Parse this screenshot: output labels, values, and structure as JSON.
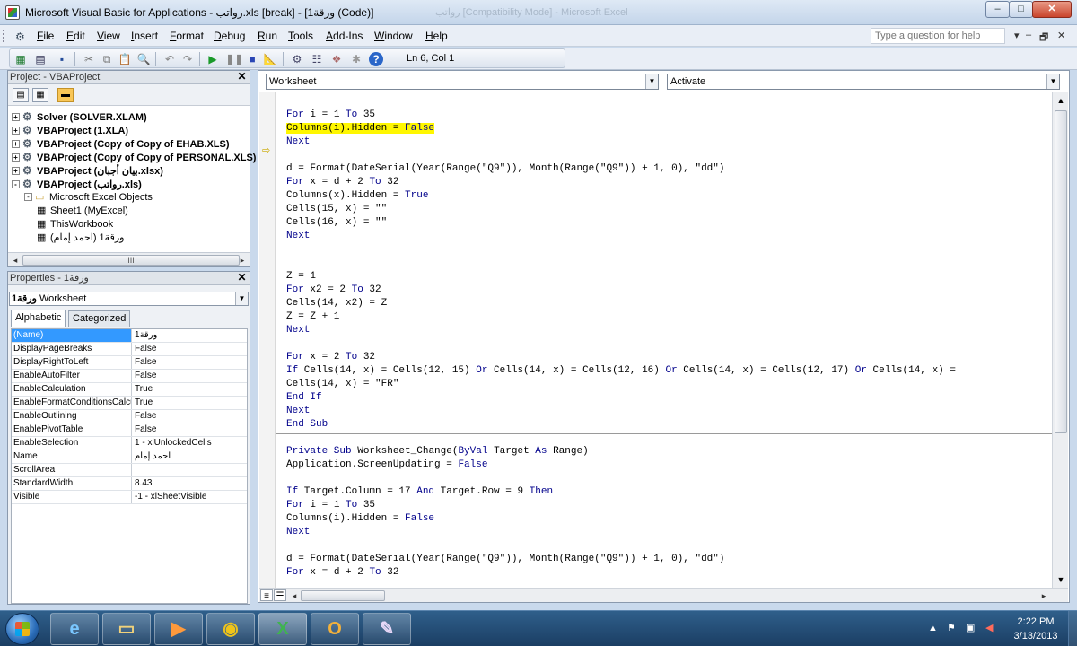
{
  "window": {
    "title": "Microsoft Visual Basic for Applications - رواتب.xls [break] - [ورقة1 (Code)]",
    "ghost_title": "رواتب [Compatibility Mode] - Microsoft Excel",
    "min_glyph": "–",
    "max_glyph": "□",
    "close_glyph": "✕"
  },
  "menu": {
    "items": [
      "File",
      "Edit",
      "View",
      "Insert",
      "Format",
      "Debug",
      "Run",
      "Tools",
      "Add-Ins",
      "Window",
      "Help"
    ],
    "help_placeholder": "Type a question for help",
    "right_controls": [
      "▾",
      "–",
      "🗗",
      "✕"
    ]
  },
  "toolbar": {
    "position": "Ln 6, Col 1",
    "icons": [
      "excel-icon",
      "insert-module-icon",
      "save-icon",
      "cut-icon",
      "copy-icon",
      "paste-icon",
      "find-icon",
      "undo-icon",
      "redo-icon",
      "run-icon",
      "break-icon",
      "reset-icon",
      "design-mode-icon",
      "project-explorer-icon",
      "properties-icon",
      "object-browser-icon",
      "toolbox-icon",
      "help-icon"
    ]
  },
  "project": {
    "title": "Project - VBAProject",
    "close": "✕",
    "tree": [
      {
        "label": "Solver (SOLVER.XLAM)",
        "level": 0,
        "expander": "+",
        "bold": true
      },
      {
        "label": "VBAProject (1.XLA)",
        "level": 0,
        "expander": "+",
        "bold": true
      },
      {
        "label": "VBAProject (Copy of Copy of EHAB.XLS)",
        "level": 0,
        "expander": "+",
        "bold": true
      },
      {
        "label": "VBAProject (Copy of Copy of PERSONAL.XLS)",
        "level": 0,
        "expander": "+",
        "bold": true
      },
      {
        "label": "VBAProject (بيان أجبان.xlsx)",
        "level": 0,
        "expander": "+",
        "bold": true
      },
      {
        "label": "VBAProject (رواتب.xls)",
        "level": 0,
        "expander": "-",
        "bold": true
      },
      {
        "label": "Microsoft Excel Objects",
        "level": 1,
        "expander": "-",
        "bold": false
      },
      {
        "label": "Sheet1 (MyExcel)",
        "level": 2,
        "expander": "",
        "bold": false
      },
      {
        "label": "ThisWorkbook",
        "level": 2,
        "expander": "",
        "bold": false
      },
      {
        "label": "ورقة1 (احمد إمام)",
        "level": 2,
        "expander": "",
        "bold": false
      }
    ],
    "scroll_label": "III"
  },
  "properties": {
    "title": "Properties - ورقة1",
    "close": "✕",
    "object_name": "ورقة1",
    "object_type": "Worksheet",
    "tabs": [
      "Alphabetic",
      "Categorized"
    ],
    "rows": [
      {
        "name": "(Name)",
        "value": "ورقة1"
      },
      {
        "name": "DisplayPageBreaks",
        "value": "False"
      },
      {
        "name": "DisplayRightToLeft",
        "value": "False"
      },
      {
        "name": "EnableAutoFilter",
        "value": "False"
      },
      {
        "name": "EnableCalculation",
        "value": "True"
      },
      {
        "name": "EnableFormatConditionsCalculation",
        "value": "True"
      },
      {
        "name": "EnableOutlining",
        "value": "False"
      },
      {
        "name": "EnablePivotTable",
        "value": "False"
      },
      {
        "name": "EnableSelection",
        "value": "1 - xlUnlockedCells"
      },
      {
        "name": "Name",
        "value": "احمد إمام"
      },
      {
        "name": "ScrollArea",
        "value": ""
      },
      {
        "name": "StandardWidth",
        "value": "8.43"
      },
      {
        "name": "Visible",
        "value": "-1 - xlSheetVisible"
      }
    ]
  },
  "code": {
    "object_combo": "Worksheet",
    "procedure_combo": "Activate",
    "lines": [
      {
        "text": "",
        "parts": []
      },
      {
        "parts": [
          [
            "kw",
            "For"
          ],
          [
            "t",
            " i = 1 "
          ],
          [
            "kw",
            "To"
          ],
          [
            "t",
            " 35"
          ]
        ]
      },
      {
        "parts": [
          [
            "t",
            "Columns(i).Hidden = "
          ],
          [
            "kw",
            "False"
          ]
        ],
        "highlight": true
      },
      {
        "parts": [
          [
            "kw",
            "Next"
          ]
        ]
      },
      {
        "parts": []
      },
      {
        "parts": [
          [
            "t",
            "d = Format(DateSerial(Year(Range(\"Q9\")), Month(Range(\"Q9\")) + 1, 0), \"dd\")"
          ]
        ]
      },
      {
        "parts": [
          [
            "kw",
            "For"
          ],
          [
            "t",
            " x = d + 2 "
          ],
          [
            "kw",
            "To"
          ],
          [
            "t",
            " 32"
          ]
        ]
      },
      {
        "parts": [
          [
            "t",
            "Columns(x).Hidden = "
          ],
          [
            "kw",
            "True"
          ]
        ]
      },
      {
        "parts": [
          [
            "t",
            "Cells(15, x) = \"\""
          ]
        ]
      },
      {
        "parts": [
          [
            "t",
            "Cells(16, x) = \"\""
          ]
        ]
      },
      {
        "parts": [
          [
            "kw",
            "Next"
          ]
        ]
      },
      {
        "parts": []
      },
      {
        "parts": []
      },
      {
        "parts": [
          [
            "t",
            "Z = 1"
          ]
        ]
      },
      {
        "parts": [
          [
            "kw",
            "For"
          ],
          [
            "t",
            " x2 = 2 "
          ],
          [
            "kw",
            "To"
          ],
          [
            "t",
            " 32"
          ]
        ]
      },
      {
        "parts": [
          [
            "t",
            "Cells(14, x2) = Z"
          ]
        ]
      },
      {
        "parts": [
          [
            "t",
            "Z = Z + 1"
          ]
        ]
      },
      {
        "parts": [
          [
            "kw",
            "Next"
          ]
        ]
      },
      {
        "parts": []
      },
      {
        "parts": [
          [
            "kw",
            "For"
          ],
          [
            "t",
            " x = 2 "
          ],
          [
            "kw",
            "To"
          ],
          [
            "t",
            " 32"
          ]
        ]
      },
      {
        "parts": [
          [
            "kw",
            "If"
          ],
          [
            "t",
            " Cells(14, x) = Cells(12, 15) "
          ],
          [
            "kw",
            "Or"
          ],
          [
            "t",
            " Cells(14, x) = Cells(12, 16) "
          ],
          [
            "kw",
            "Or"
          ],
          [
            "t",
            " Cells(14, x) = Cells(12, 17) "
          ],
          [
            "kw",
            "Or"
          ],
          [
            "t",
            " Cells(14, x) ="
          ]
        ]
      },
      {
        "parts": [
          [
            "t",
            "Cells(14, x) = \"FR\""
          ]
        ]
      },
      {
        "parts": [
          [
            "kw",
            "End If"
          ]
        ]
      },
      {
        "parts": [
          [
            "kw",
            "Next"
          ]
        ]
      },
      {
        "parts": [
          [
            "kw",
            "End Sub"
          ]
        ]
      },
      {
        "parts": []
      },
      {
        "parts": [
          [
            "kw",
            "Private Sub"
          ],
          [
            "t",
            " Worksheet_Change("
          ],
          [
            "kw",
            "ByVal"
          ],
          [
            "t",
            " Target "
          ],
          [
            "kw",
            "As"
          ],
          [
            "t",
            " Range)"
          ]
        ]
      },
      {
        "parts": [
          [
            "t",
            "Application.ScreenUpdating = "
          ],
          [
            "kw",
            "False"
          ]
        ]
      },
      {
        "parts": []
      },
      {
        "parts": [
          [
            "kw",
            "If"
          ],
          [
            "t",
            " Target.Column = 17 "
          ],
          [
            "kw",
            "And"
          ],
          [
            "t",
            " Target.Row = 9 "
          ],
          [
            "kw",
            "Then"
          ]
        ]
      },
      {
        "parts": [
          [
            "kw",
            "For"
          ],
          [
            "t",
            " i = 1 "
          ],
          [
            "kw",
            "To"
          ],
          [
            "t",
            " 35"
          ]
        ]
      },
      {
        "parts": [
          [
            "t",
            "Columns(i).Hidden = "
          ],
          [
            "kw",
            "False"
          ]
        ]
      },
      {
        "parts": [
          [
            "kw",
            "Next"
          ]
        ]
      },
      {
        "parts": []
      },
      {
        "parts": [
          [
            "t",
            "d = Format(DateSerial(Year(Range(\"Q9\")), Month(Range(\"Q9\")) + 1, 0), \"dd\")"
          ]
        ]
      },
      {
        "parts": [
          [
            "kw",
            "For"
          ],
          [
            "t",
            " x = d + 2 "
          ],
          [
            "kw",
            "To"
          ],
          [
            "t",
            " 32"
          ]
        ]
      }
    ]
  },
  "taskbar": {
    "apps": [
      "start-button",
      "internet-explorer-icon",
      "file-explorer-icon",
      "media-player-icon",
      "chrome-icon",
      "excel-icon",
      "outlook-icon",
      "paint-icon"
    ],
    "time": "2:22 PM",
    "date": "3/13/2013"
  },
  "colors": {
    "keyword": "#00008b",
    "highlight": "#fff700",
    "selection": "#3399ff"
  }
}
